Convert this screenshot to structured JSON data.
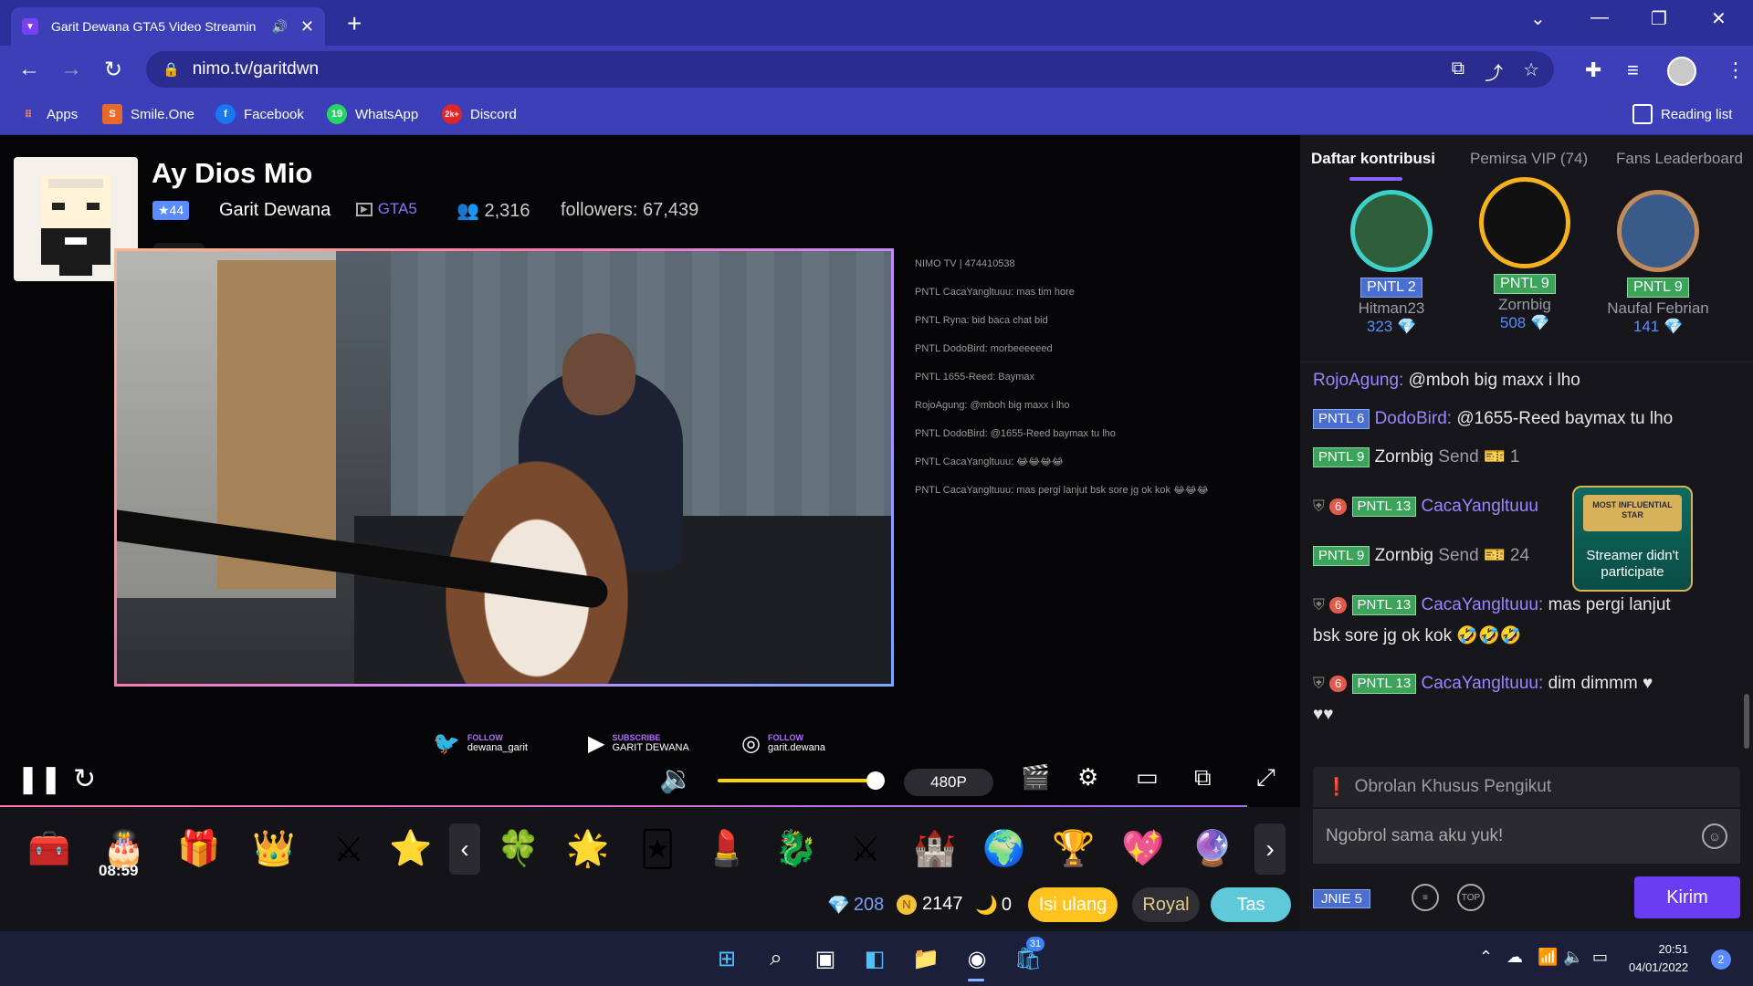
{
  "browser": {
    "tab_title": "Garit Dewana GTA5 Video Streamin",
    "new_tab": "+",
    "url": "nimo.tv/garitdwn",
    "reading_list": "Reading list",
    "bookmarks": [
      "Apps",
      "Smile.One",
      "Facebook",
      "WhatsApp",
      "Discord"
    ],
    "whatsapp_badge": "19",
    "discord_badge": "2k+"
  },
  "room": {
    "title": "Ay Dios Mio",
    "level": "★44",
    "streamer": "Garit Dewana",
    "game": "GTA5",
    "viewers": "2,316",
    "followers": "followers: 67,439"
  },
  "overlay_chat": [
    "NIMO TV | 474410538",
    "PNTL CacaYangltuuu: mas tim hore",
    "PNTL Ryna: bid baca chat bid",
    "PNTL DodoBird: morbeeeeeed",
    "PNTL 1655-Reed: Baymax",
    "RojoAgung: @mboh big maxx i lho",
    "PNTL DodoBird: @1655-Reed baymax tu lho",
    "PNTL CacaYangltuuu: 😂😂😂😂",
    "PNTL CacaYangltuuu: mas pergi lanjut bsk sore jg ok kok 😂😂😂"
  ],
  "socials": [
    {
      "tag": "FOLLOW",
      "handle": "dewana_garit"
    },
    {
      "tag": "SUBSCRIBE",
      "handle": "GARIT DEWANA"
    },
    {
      "tag": "FOLLOW",
      "handle": "garit.dewana"
    }
  ],
  "player": {
    "quality": "480P",
    "volume": 0.95
  },
  "gifts": {
    "timer": "08:59"
  },
  "wallet": {
    "diamonds": "208",
    "coins": "2147",
    "beans": "0",
    "topup": "Isi ulang",
    "royal": "Royal",
    "bag": "Tas"
  },
  "panel": {
    "tabs": [
      "Daftar kontribusi",
      "Pemirsa VIP (74)",
      "Fans Leaderboard"
    ],
    "top3": [
      {
        "rank": "2",
        "badge": "PNTL 2",
        "name": "Hitman23",
        "points": "323"
      },
      {
        "rank": "1",
        "badge": "PNTL 9",
        "name": "Zornbig",
        "points": "508"
      },
      {
        "rank": "3",
        "badge": "PNTL 9",
        "name": "Naufal Febrian",
        "points": "141"
      }
    ]
  },
  "chat": {
    "m1_name": "RojoAgung:",
    "m1_text": "@mboh big maxx i lho",
    "m2_badge": "PNTL 6",
    "m2_name": "DodoBird:",
    "m2_text": "@1655-Reed baymax tu lho",
    "m3_badge": "PNTL 9",
    "m3_name": "Zornbig",
    "m3_send": "Send",
    "m3_count": "1",
    "m4_red": "6",
    "m4_badge": "PNTL 13",
    "m4_name": "CacaYangltuuu",
    "m5_badge": "PNTL 9",
    "m5_name": "Zornbig",
    "m5_send": "Send",
    "m5_count": "24",
    "m6_red": "6",
    "m6_badge": "PNTL 13",
    "m6_name": "CacaYangltuuu:",
    "m6_text": "mas pergi lanjut",
    "m6_text2": "bsk sore jg ok kok 🤣🤣🤣",
    "m7_red": "6",
    "m7_badge": "PNTL 13",
    "m7_name": "CacaYangltuuu:",
    "m7_text": "dim dimmm ♥",
    "m7_text2": "♥♥",
    "influencer_banner": "MOST INFLUENTIAL STAR",
    "influencer_text": "Streamer didn't participate",
    "follower_only": "Obrolan Khusus Pengikut",
    "input_placeholder": "Ngobrol sama aku yuk!",
    "user_badge": "JNIE 5",
    "top_label": "TOP",
    "send_button": "Kirim"
  },
  "taskbar": {
    "time": "20:51",
    "date": "04/01/2022",
    "notifications": "2",
    "store_badge": "31"
  }
}
